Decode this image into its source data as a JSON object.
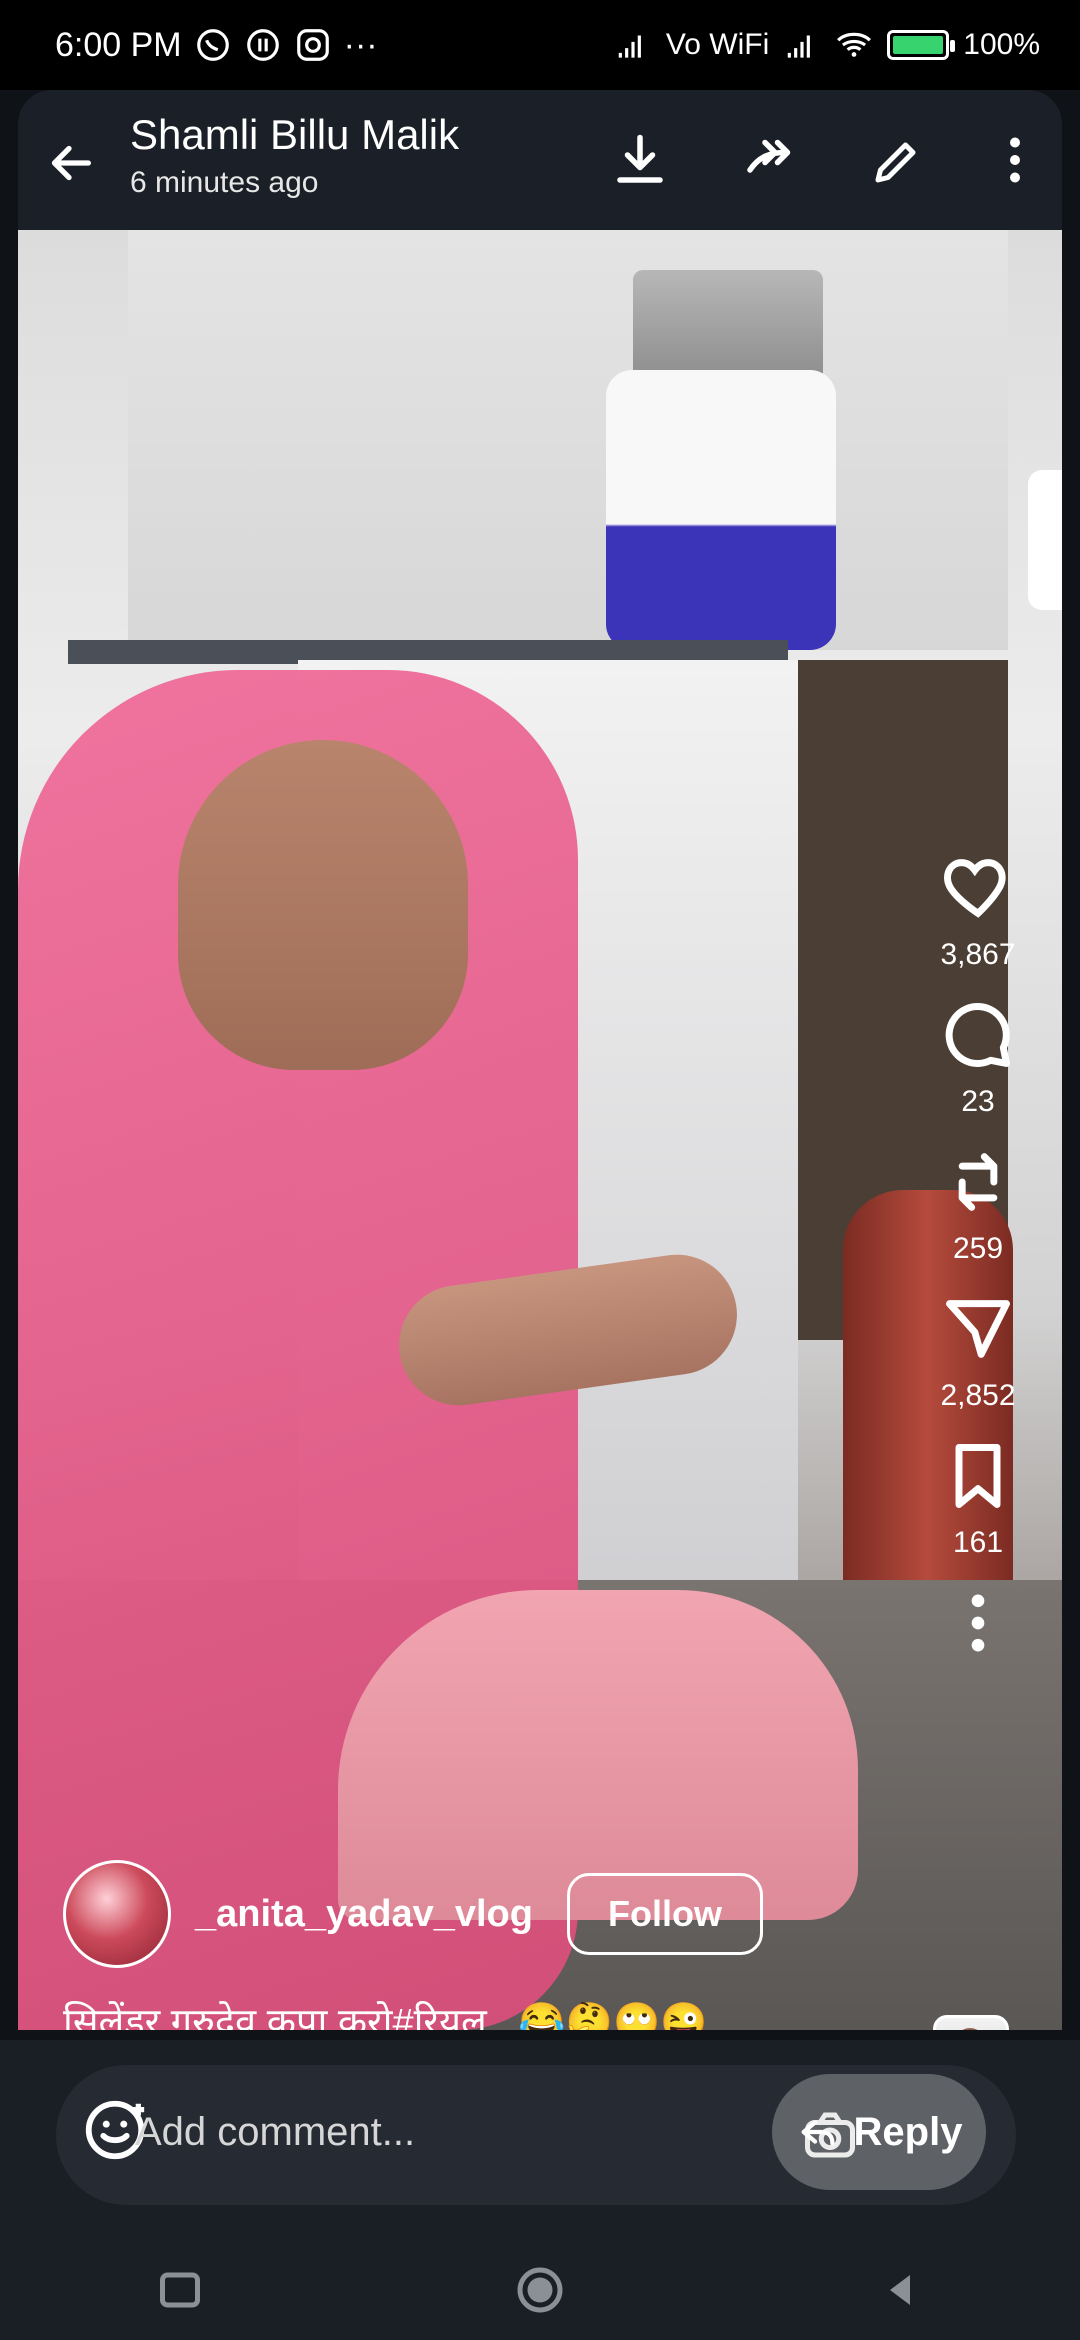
{
  "status_bar": {
    "time": "6:00 PM",
    "ellipsis": "···",
    "network_label": "Vo WiFi",
    "battery": "100%"
  },
  "header": {
    "title": "Shamli Billu Malik",
    "subtitle": "6 minutes ago"
  },
  "actions": [
    {
      "icon": "heart-icon",
      "count": "3,867"
    },
    {
      "icon": "comment-icon",
      "count": "23"
    },
    {
      "icon": "repost-icon",
      "count": "259"
    },
    {
      "icon": "send-icon",
      "count": "2,852"
    },
    {
      "icon": "bookmark-icon",
      "count": "161"
    }
  ],
  "author": {
    "username": "_anita_yadav_vlog",
    "follow_label": "Follow"
  },
  "caption": "सिलेंडर गुरुदेव कृपा करो#रियल , 😂🤔🙄😜 ...",
  "comment": {
    "placeholder": "Add comment...",
    "reply_label": "Reply"
  },
  "progress": {
    "value": 0.48
  },
  "colors": {
    "accent_pink": "#e65b8d",
    "battery_green": "#36d36f"
  }
}
